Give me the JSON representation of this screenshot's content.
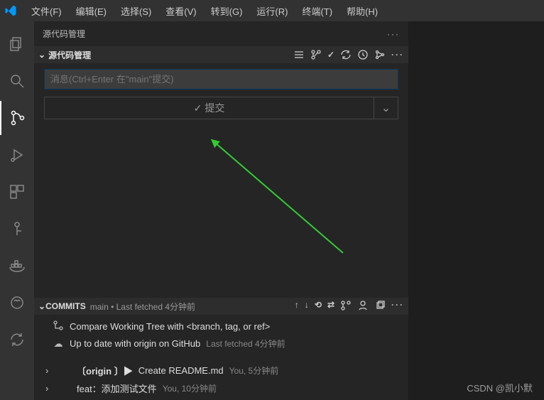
{
  "menubar": {
    "items": [
      "文件(F)",
      "编辑(E)",
      "选择(S)",
      "查看(V)",
      "转到(G)",
      "运行(R)",
      "终端(T)",
      "帮助(H)"
    ]
  },
  "panel": {
    "title": "源代码管理",
    "more": "···"
  },
  "scm": {
    "header": "源代码管理",
    "input_placeholder": "消息(Ctrl+Enter 在\"main\"提交)",
    "commit_button": "提交"
  },
  "commits": {
    "header": "COMMITS",
    "branch_info": "main • Last fetched 4分钟前",
    "rows": {
      "compare": "Compare Working Tree with <branch, tag, or ref>",
      "uptodate": "Up to date with origin on GitHub",
      "uptodate_sub": "Last fetched 4分钟前",
      "c1_ref": "〔origin 〕▶",
      "c1_msg": "Create README.md",
      "c1_meta": "You, 5分钟前",
      "c2_msg": "feat：添加测试文件",
      "c2_meta": "You, 10分钟前"
    }
  },
  "watermark": "CSDN @凯小默"
}
